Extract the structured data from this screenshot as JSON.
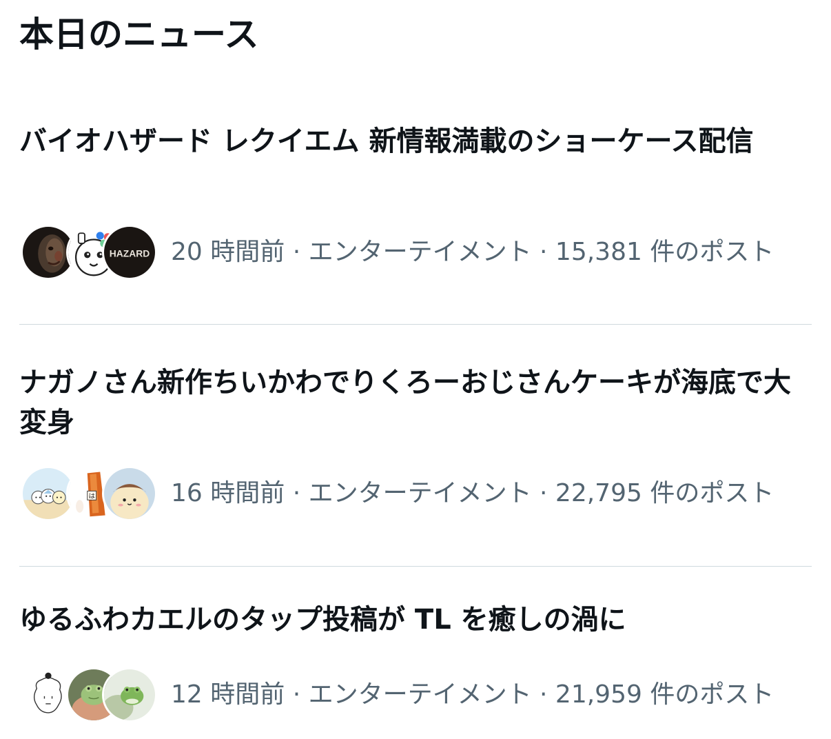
{
  "section": {
    "title": "本日のニュース"
  },
  "news": [
    {
      "headline": "バイオハザード レクイエム 新情報満載のショーケース配信",
      "meta": "20 時間前 · エンターテイメント · 15,381 件のポスト",
      "avatars": [
        "zombie-face-avatar",
        "cartoon-character-avatar",
        "hazard-logo-avatar"
      ],
      "avatar_logo_text": "HAZARD"
    },
    {
      "headline": "ナガノさん新作ちいかわでりくろーおじさんケーキが海底で大変身",
      "meta": "16 時間前 · エンターテイメント · 22,795 件のポスト",
      "avatars": [
        "chiikawa-group-avatar",
        "orange-figure-avatar",
        "hachiware-avatar"
      ]
    },
    {
      "headline": "ゆるふわカエルのタップ投稿が TL を癒しの渦に",
      "meta": "12 時間前 · エンターテイメント · 21,959 件のポスト",
      "avatars": [
        "line-drawing-avatar",
        "frog-in-hand-avatar",
        "green-frog-avatar"
      ]
    }
  ],
  "colors": {
    "text_primary": "#0f1419",
    "text_secondary": "#536471",
    "divider": "#cfd9de"
  }
}
